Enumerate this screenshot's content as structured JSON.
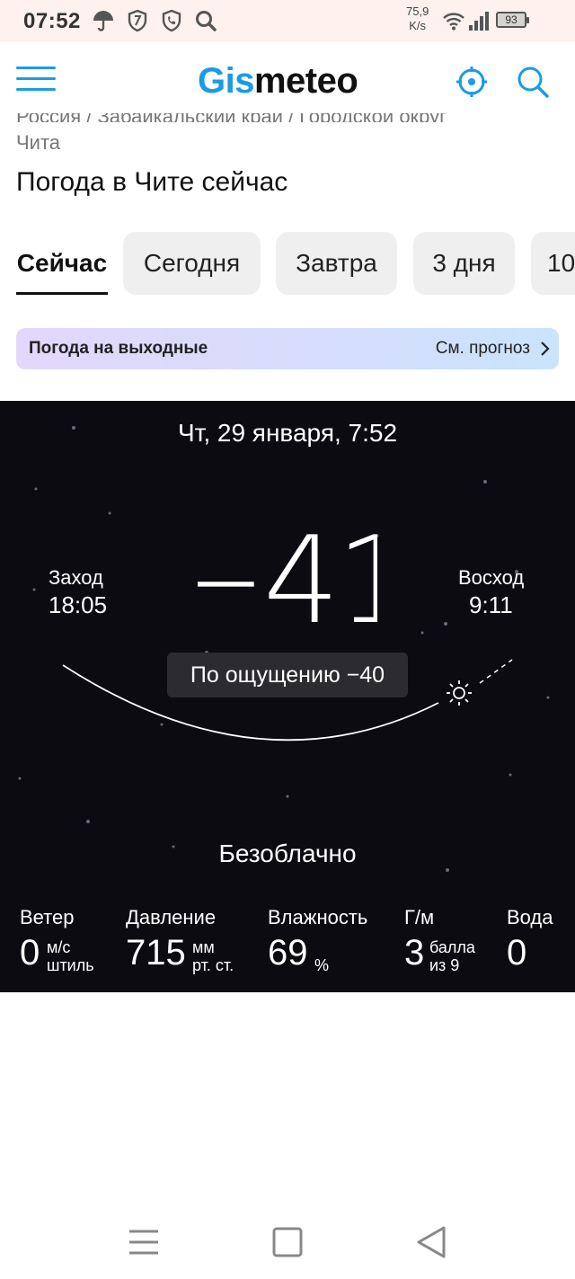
{
  "status_bar": {
    "time": "07:52",
    "speed_value": "75,9",
    "speed_unit": "K/s",
    "battery": "93",
    "icons": [
      "umbrella-icon",
      "shield-icon",
      "shield-phone-icon",
      "search-icon",
      "wifi-icon",
      "signal-icon",
      "battery-icon"
    ]
  },
  "header": {
    "logo_part1": "Gis",
    "logo_part2": "meteo",
    "accent_color": "#1a9be6",
    "icons": [
      "menu-icon",
      "location-icon",
      "search-icon"
    ]
  },
  "breadcrumb": {
    "path": "Россия / Забайкальский край / Городской округ",
    "city": "Чита"
  },
  "page_title": "Погода в Чите сейчас",
  "tabs": [
    {
      "label": "Сейчас",
      "active": true
    },
    {
      "label": "Сегодня",
      "active": false
    },
    {
      "label": "Завтра",
      "active": false
    },
    {
      "label": "3 дня",
      "active": false
    },
    {
      "label": "10",
      "active": false
    }
  ],
  "weekend_banner": {
    "label": "Погода на выходные",
    "link": "См. прогноз"
  },
  "weather": {
    "date": "Чт, 29 января, 7:52",
    "temperature": "−41",
    "sunset_label": "Заход",
    "sunset_time": "18:05",
    "sunrise_label": "Восход",
    "sunrise_time": "9:11",
    "feels_like": "По ощущению −40",
    "condition": "Безоблачно",
    "metrics": {
      "wind": {
        "label": "Ветер",
        "value": "0",
        "unit_line1": "м/с",
        "unit_line2": "штиль"
      },
      "pressure": {
        "label": "Давление",
        "value": "715",
        "unit_line1": "мм",
        "unit_line2": "рт. ст."
      },
      "humidity": {
        "label": "Влажность",
        "value": "69",
        "unit_line1": "%"
      },
      "geomagnetic": {
        "label": "Г/м",
        "value": "3",
        "unit_line1": "балла",
        "unit_line2": "из 9"
      },
      "water": {
        "label": "Вода",
        "value": "0"
      }
    }
  },
  "nav_bar": {
    "icons": [
      "recent-apps-icon",
      "home-icon",
      "back-icon"
    ]
  }
}
